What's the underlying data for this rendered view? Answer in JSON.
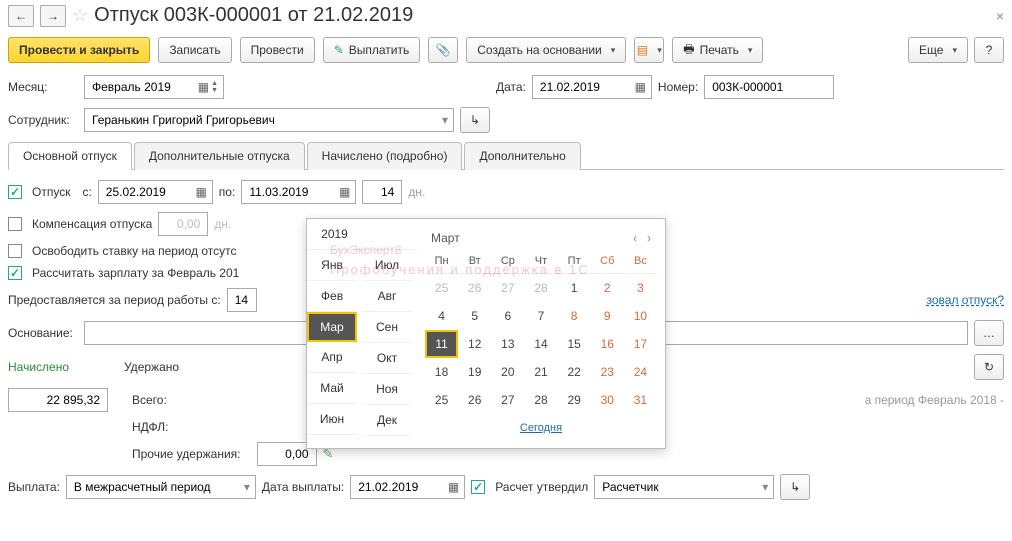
{
  "header": {
    "title": "Отпуск 003К-000001 от 21.02.2019"
  },
  "toolbar": {
    "post_close": "Провести и закрыть",
    "save": "Записать",
    "post": "Провести",
    "pay": "Выплатить",
    "create_based": "Создать на основании",
    "print": "Печать",
    "more": "Еще"
  },
  "fields": {
    "month_lbl": "Месяц:",
    "month_val": "Февраль 2019",
    "date_lbl": "Дата:",
    "date_val": "21.02.2019",
    "number_lbl": "Номер:",
    "number_val": "003К-000001",
    "employee_lbl": "Сотрудник:",
    "employee_val": "Геранькин Григорий Григорьевич"
  },
  "tabs": {
    "t1": "Основной отпуск",
    "t2": "Дополнительные отпуска",
    "t3": "Начислено (подробно)",
    "t4": "Дополнительно"
  },
  "vac": {
    "vac_lbl": "Отпуск",
    "from_lbl": "с:",
    "from_val": "25.02.2019",
    "to_lbl": "по:",
    "to_val": "11.03.2019",
    "days_val": "14",
    "days_lbl": "дн.",
    "comp_lbl": "Компенсация отпуска",
    "comp_val": "0,00",
    "comp_days": "дн.",
    "free_rate": "Освободить ставку на период отсутс",
    "calc_salary": "Рассчитать зарплату за Февраль 201",
    "period_lbl": "Предоставляется за период работы с:",
    "period_val": "14",
    "used_link": "зовал отпуск?",
    "basis_lbl": "Основание:"
  },
  "accr": {
    "accrued_lbl": "Начислено",
    "accrued_val": "22 895,32",
    "withheld_lbl": "Удержано",
    "total_lbl": "Всего:",
    "ndfl_lbl": "НДФЛ:",
    "other_lbl": "Прочие удержания:",
    "other_val": "0,00",
    "period_note": "а период Февраль 2018 -"
  },
  "footer": {
    "payment_lbl": "Выплата:",
    "payment_val": "В межрасчетный период",
    "paydate_lbl": "Дата выплаты:",
    "paydate_val": "21.02.2019",
    "approved_lbl": "Расчет утвердил",
    "approver_val": "Расчетчик"
  },
  "dp": {
    "year": "2019",
    "month": "Март",
    "months1": [
      "Янв",
      "Фев",
      "Мар",
      "Апр",
      "Май",
      "Июн"
    ],
    "months2": [
      "Июл",
      "Авг",
      "Сен",
      "Окт",
      "Ноя",
      "Дек"
    ],
    "today": "Сегодня",
    "dh": [
      "Пн",
      "Вт",
      "Ср",
      "Чт",
      "Пт",
      "Сб",
      "Вс"
    ],
    "grid": [
      [
        25,
        26,
        27,
        28,
        1,
        2,
        3
      ],
      [
        4,
        5,
        6,
        7,
        8,
        9,
        10
      ],
      [
        11,
        12,
        13,
        14,
        15,
        16,
        17
      ],
      [
        18,
        19,
        20,
        21,
        22,
        23,
        24
      ],
      [
        25,
        26,
        27,
        28,
        29,
        30,
        31
      ]
    ]
  },
  "watermark": {
    "main": "БухЭксперт8",
    "sub": "Профобучения и поддержка в 1С"
  }
}
